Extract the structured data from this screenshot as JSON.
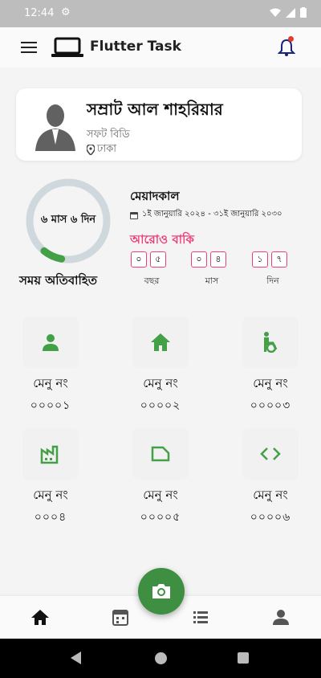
{
  "status_bar": {
    "time": "12:44"
  },
  "app_bar": {
    "title": "Flutter Task"
  },
  "profile": {
    "name": "সম্রাট আল শাহরিয়ার",
    "org": "সফট বিডি",
    "location": "ঢাকা"
  },
  "progress": {
    "center_label": "৬ মাস ৬ দিন",
    "elapsed_label": "সময় অতিবাহিত",
    "fraction": 0.08
  },
  "tenure": {
    "title": "মেয়াদকাল",
    "range": "১ই জানুয়ারি ২০২৪ - ৩১ই জানুয়ারি ২০৩০"
  },
  "remaining": {
    "title": "আরোও বাকি",
    "years": [
      "০",
      "৫"
    ],
    "months": [
      "০",
      "৪"
    ],
    "days": [
      "১",
      "৭"
    ],
    "years_label": "বছর",
    "months_label": "মাস",
    "days_label": "দিন"
  },
  "menus": [
    {
      "label": "মেনু নং",
      "num": "০০০০১",
      "icon": "person-icon"
    },
    {
      "label": "মেনু নং",
      "num": "০০০০২",
      "icon": "home-icon"
    },
    {
      "label": "মেনু নং",
      "num": "০০০০৩",
      "icon": "accessible-icon"
    },
    {
      "label": "মেনু নং",
      "num": "০০০৪",
      "icon": "factory-icon"
    },
    {
      "label": "মেনু নং",
      "num": "০০০০৫",
      "icon": "label-icon"
    },
    {
      "label": "মেনু নং",
      "num": "০০০০৬",
      "icon": "code-icon"
    }
  ],
  "colors": {
    "accent": "#43a047",
    "pink": "#ec407a",
    "fab": "#3f8f43"
  },
  "bottom_nav": [
    "home-icon",
    "calendar-icon",
    "list-icon",
    "person-icon"
  ]
}
